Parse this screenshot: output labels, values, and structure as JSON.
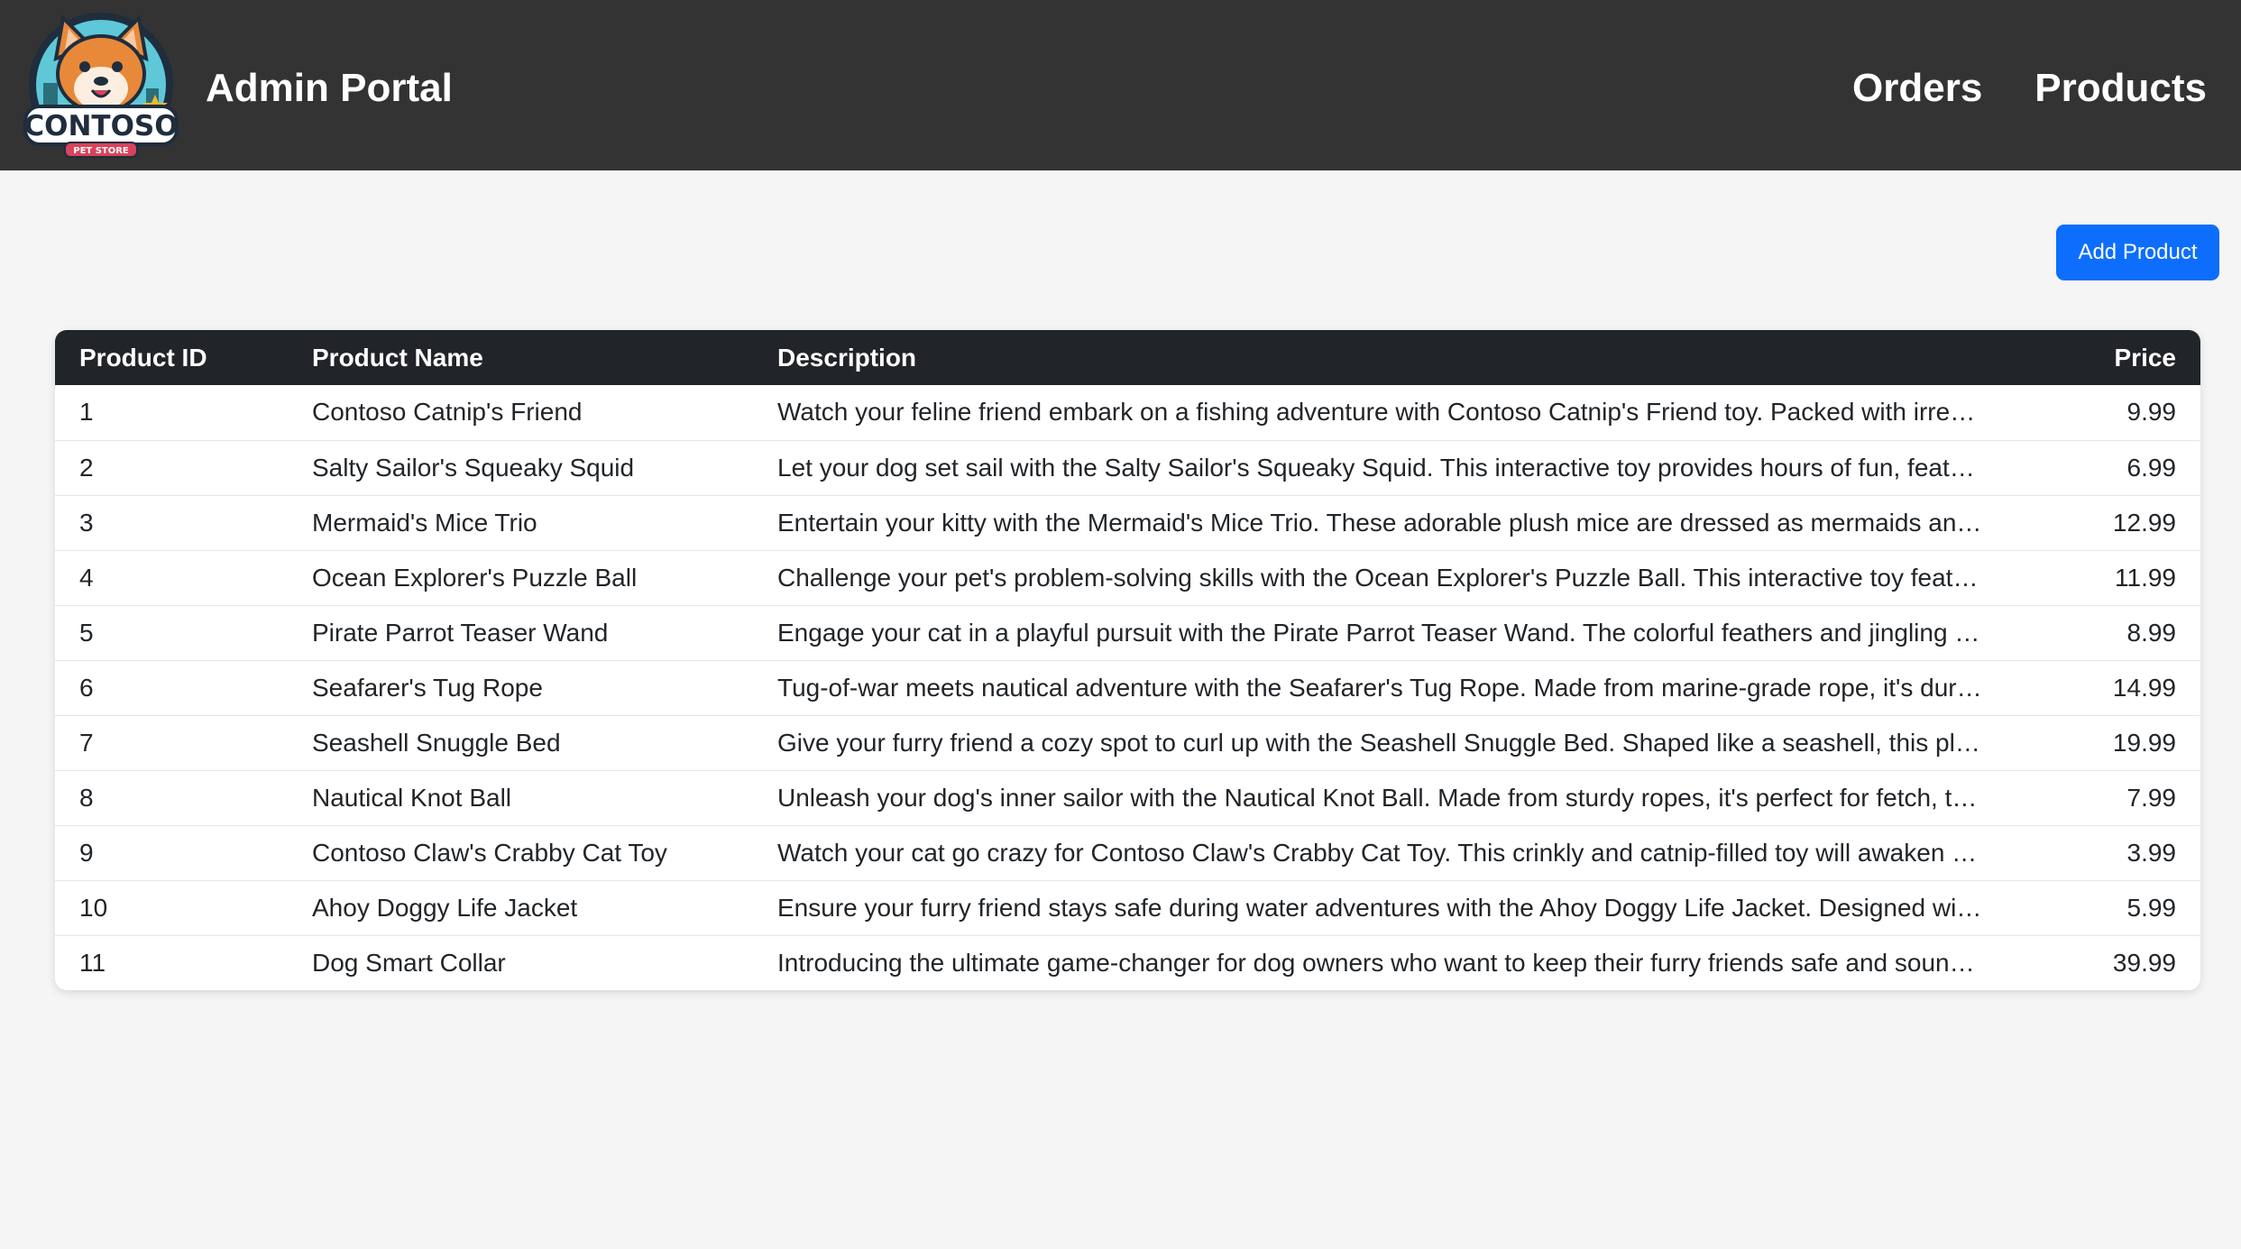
{
  "header": {
    "logo_text": "CONTOSO",
    "logo_subtext": "PET STORE",
    "title": "Admin Portal",
    "nav": [
      {
        "label": "Orders"
      },
      {
        "label": "Products"
      }
    ],
    "background_color": "#333333"
  },
  "actions": {
    "add_product_label": "Add Product",
    "accent_color": "#0d6efd"
  },
  "table": {
    "columns": [
      "Product ID",
      "Product Name",
      "Description",
      "Price"
    ],
    "rows": [
      {
        "id": "1",
        "name": "Contoso Catnip's Friend",
        "description": "Watch your feline friend embark on a fishing adventure with Contoso Catnip's Friend toy. Packed with irresistible catnip and dangling fish lure.",
        "price": "9.99"
      },
      {
        "id": "2",
        "name": "Salty Sailor's Squeaky Squid",
        "description": "Let your dog set sail with the Salty Sailor's Squeaky Squid. This interactive toy provides hours of fun, featuring multiple squeakers and crinkle tentacles.",
        "price": "6.99"
      },
      {
        "id": "3",
        "name": "Mermaid's Mice Trio",
        "description": "Entertain your kitty with the Mermaid's Mice Trio. These adorable plush mice are dressed as mermaids and filled with catnip to captivate any cat.",
        "price": "12.99"
      },
      {
        "id": "4",
        "name": "Ocean Explorer's Puzzle Ball",
        "description": "Challenge your pet's problem-solving skills with the Ocean Explorer's Puzzle Ball. This interactive toy features hidden compartments and treats.",
        "price": "11.99"
      },
      {
        "id": "5",
        "name": "Pirate Parrot Teaser Wand",
        "description": "Engage your cat in a playful pursuit with the Pirate Parrot Teaser Wand. The colorful feathers and jingling bells will keep your cat entertained.",
        "price": "8.99"
      },
      {
        "id": "6",
        "name": "Seafarer's Tug Rope",
        "description": "Tug-of-war meets nautical adventure with the Seafarer's Tug Rope. Made from marine-grade rope, it's durable enough for the toughest games.",
        "price": "14.99"
      },
      {
        "id": "7",
        "name": "Seashell Snuggle Bed",
        "description": "Give your furry friend a cozy spot to curl up with the Seashell Snuggle Bed. Shaped like a seashell, this plush bed provides comfort and style.",
        "price": "19.99"
      },
      {
        "id": "8",
        "name": "Nautical Knot Ball",
        "description": "Unleash your dog's inner sailor with the Nautical Knot Ball. Made from sturdy ropes, it's perfect for fetch, tug, and chewing sessions.",
        "price": "7.99"
      },
      {
        "id": "9",
        "name": "Contoso Claw's Crabby Cat Toy",
        "description": "Watch your cat go crazy for Contoso Claw's Crabby Cat Toy. This crinkly and catnip-filled toy will awaken your cat's hunting instincts.",
        "price": "3.99"
      },
      {
        "id": "10",
        "name": "Ahoy Doggy Life Jacket",
        "description": "Ensure your furry friend stays safe during water adventures with the Ahoy Doggy Life Jacket. Designed with reflective strips and a handle.",
        "price": "5.99"
      },
      {
        "id": "11",
        "name": "Dog Smart Collar",
        "description": "Introducing the ultimate game-changer for dog owners who want to keep their furry friends safe and sound with real-time tracking.",
        "price": "39.99"
      }
    ]
  }
}
